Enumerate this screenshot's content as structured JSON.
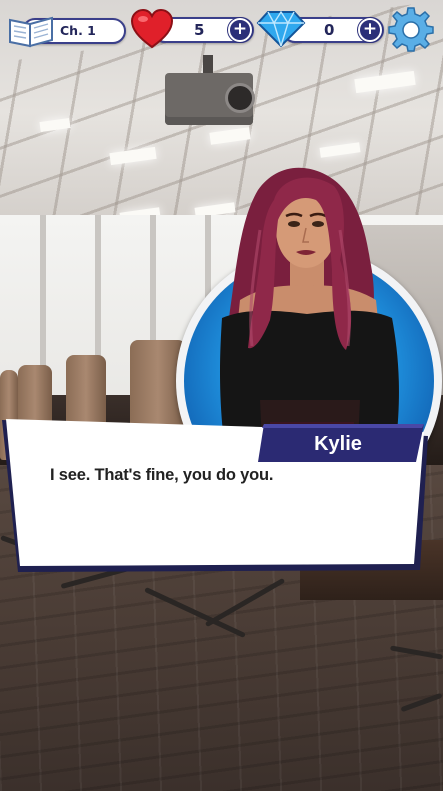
{
  "hud": {
    "chapter_label": "Ch. 1",
    "hearts_count": "5",
    "diamonds_count": "0",
    "heart_color": "#e0202a",
    "diamond_color": "#2fa8ee",
    "accent_color": "#2b2f79"
  },
  "icons": {
    "book": "book-icon",
    "heart": "heart-icon",
    "diamond": "diamond-icon",
    "plus": "plus-icon",
    "settings": "gear-icon"
  },
  "dialogue": {
    "speaker": "Kylie",
    "line": "I see. That's fine, you do you."
  },
  "colors": {
    "nameplate": "#2b2a73",
    "dialog_border": "#1f2050",
    "portrait_blue": "#1f8fdc"
  }
}
